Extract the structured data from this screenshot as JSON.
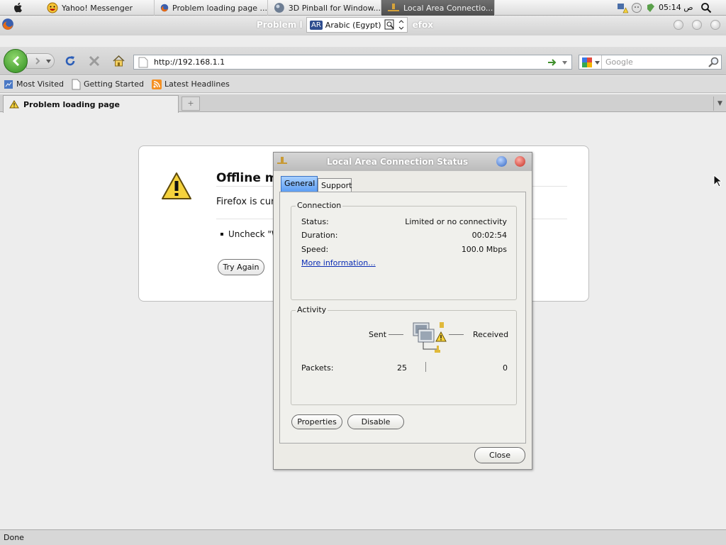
{
  "menubar": {
    "tabs": [
      {
        "label": "Yahoo! Messenger",
        "icon": "smiley-icon"
      },
      {
        "label": "Problem loading page ...",
        "icon": "firefox-icon"
      },
      {
        "label": "3D Pinball for Window...",
        "icon": "pinball-icon"
      },
      {
        "label": "Local Area Connectio...",
        "icon": "network-icon"
      }
    ],
    "clock": "05:14 ص"
  },
  "window": {
    "title_left": "Problem l",
    "title_right": "efox",
    "language": {
      "badge": "AR",
      "label": "Arabic (Egypt)"
    }
  },
  "navigation": {
    "url": "http://192.168.1.1",
    "search_placeholder": "Google"
  },
  "bookmarks": [
    {
      "label": "Most Visited"
    },
    {
      "label": "Getting Started"
    },
    {
      "label": "Latest Headlines"
    }
  ],
  "tabs": [
    {
      "label": "Problem loading page"
    }
  ],
  "error_page": {
    "title": "Offline m",
    "description": "Firefox is curr",
    "bullet": "Uncheck \"W",
    "try_again_label": "Try Again"
  },
  "dialog": {
    "title": "Local Area Connection Status",
    "tabs": [
      {
        "label": "General",
        "active": true
      },
      {
        "label": "Support",
        "active": false
      }
    ],
    "connection": {
      "group_label": "Connection",
      "status_label": "Status:",
      "status_value": "Limited or no connectivity",
      "duration_label": "Duration:",
      "duration_value": "00:02:54",
      "speed_label": "Speed:",
      "speed_value": "100.0 Mbps",
      "more_info_link": "More information..."
    },
    "activity": {
      "group_label": "Activity",
      "sent_label": "Sent",
      "received_label": "Received",
      "packets_label": "Packets:",
      "packets_sent": "25",
      "packets_received": "0"
    },
    "properties_label": "Properties",
    "disable_label": "Disable",
    "close_label": "Close"
  },
  "status_bar": {
    "text": "Done"
  },
  "colors": {
    "warning": "#f5d23c",
    "link": "#0a2cb5",
    "active_tab": "#5d9ef3"
  }
}
